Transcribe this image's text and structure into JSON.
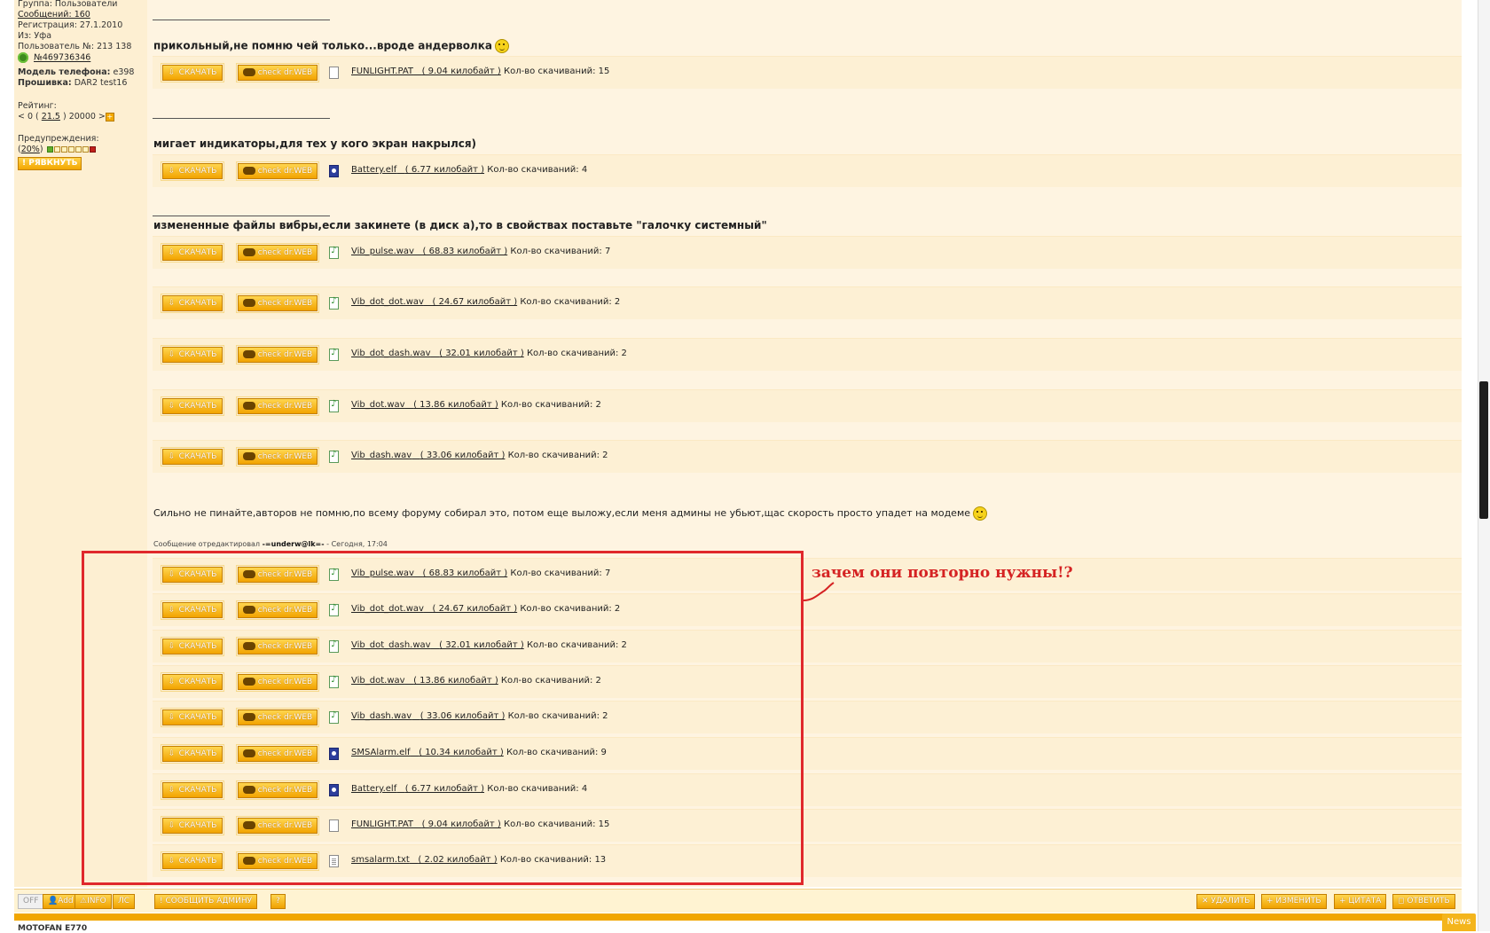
{
  "sidebar": {
    "group": "Группа: Пользователи",
    "messages": "Сообщений: 160",
    "registration": "Регистрация: 27.1.2010",
    "from": "Из: Уфа",
    "user_number": "Пользователь №: 213 138",
    "icq": "№469736346",
    "phone_label": "Модель телефона:",
    "phone_value": "e398",
    "firmware_label": "Прошивка:",
    "firmware_value": "DAR2 test16",
    "rating_label": "Рейтинг:",
    "rating_prefix": "< 0 (",
    "rating_value": "21.5",
    "rating_suffix": ") 20000 >",
    "warnings_label": "Предупреждения:",
    "warnings_value": "20%",
    "ryavknut_label": "РЯВКНУТЬ"
  },
  "post": {
    "section1_title": "прикольный,не помню чей только...вроде андерволка",
    "section2_title": "мигает индикаторы,для тех у кого экран накрылся)",
    "section3_title": "измененные файлы вибры,если закинете (в диск а),то в свойствах поставьте \"галочку системный\"",
    "closing_text": "Сильно не пинайте,авторов не помню,по всему форуму собирал это, потом еще выложу,если меня админы не убьют,щас скорость просто упадет на модеме",
    "edited_prefix": "Сообщение отредактировал",
    "edited_user": "-=underw@lk=-",
    "edited_time": "- Сегодня, 17:04"
  },
  "buttons": {
    "download": "СКАЧАТЬ",
    "drweb": "check dr.WEB"
  },
  "downloads_label": "Кол-во скачиваний:",
  "files_top": [
    {
      "name": "FUNLIGHT.PAT",
      "size": "( 9.04 килобайт )",
      "count": "15",
      "type": "pat"
    },
    {
      "name": "Battery.elf",
      "size": "( 6.77 килобайт )",
      "count": "4",
      "type": "elf"
    },
    {
      "name": "Vib_pulse.wav",
      "size": "( 68.83 килобайт )",
      "count": "7",
      "type": "wav"
    },
    {
      "name": "Vib_dot_dot.wav",
      "size": "( 24.67 килобайт )",
      "count": "2",
      "type": "wav"
    },
    {
      "name": "Vib_dot_dash.wav",
      "size": "( 32.01 килобайт )",
      "count": "2",
      "type": "wav"
    },
    {
      "name": "Vib_dot.wav",
      "size": "( 13.86 килобайт )",
      "count": "2",
      "type": "wav"
    },
    {
      "name": "Vib_dash.wav",
      "size": "( 33.06 килобайт )",
      "count": "2",
      "type": "wav"
    }
  ],
  "files_attached": [
    {
      "name": "Vib_pulse.wav",
      "size": "( 68.83 килобайт )",
      "count": "7",
      "type": "wav"
    },
    {
      "name": "Vib_dot_dot.wav",
      "size": "( 24.67 килобайт )",
      "count": "2",
      "type": "wav"
    },
    {
      "name": "Vib_dot_dash.wav",
      "size": "( 32.01 килобайт )",
      "count": "2",
      "type": "wav"
    },
    {
      "name": "Vib_dot.wav",
      "size": "( 13.86 килобайт )",
      "count": "2",
      "type": "wav"
    },
    {
      "name": "Vib_dash.wav",
      "size": "( 33.06 килобайт )",
      "count": "2",
      "type": "wav"
    },
    {
      "name": "SMSAlarm.elf",
      "size": "( 10.34 килобайт )",
      "count": "9",
      "type": "elf"
    },
    {
      "name": "Battery.elf",
      "size": "( 6.77 килобайт )",
      "count": "4",
      "type": "elf"
    },
    {
      "name": "FUNLIGHT.PAT",
      "size": "( 9.04 килобайт )",
      "count": "15",
      "type": "pat"
    },
    {
      "name": "smsalarm.txt",
      "size": "( 2.02 килобайт )",
      "count": "13",
      "type": "txt"
    }
  ],
  "annotation": "зачем они повторно нужны!?",
  "annotation_color": "#d52323",
  "bottom_bar": {
    "off": "OFF",
    "add": "Add",
    "info": "INFO",
    "pm": "ЛС",
    "report": "СООБЩИТЬ АДМИНУ",
    "delete": "УДАЛИТЬ",
    "edit": "ИЗМЕНИТЬ",
    "quote": "ЦИТАТА",
    "reply": "ОТВЕТИТЬ"
  },
  "footer": {
    "next_user": "MOTOFAN E770",
    "news": "News"
  },
  "accent_color": "#f1a600"
}
